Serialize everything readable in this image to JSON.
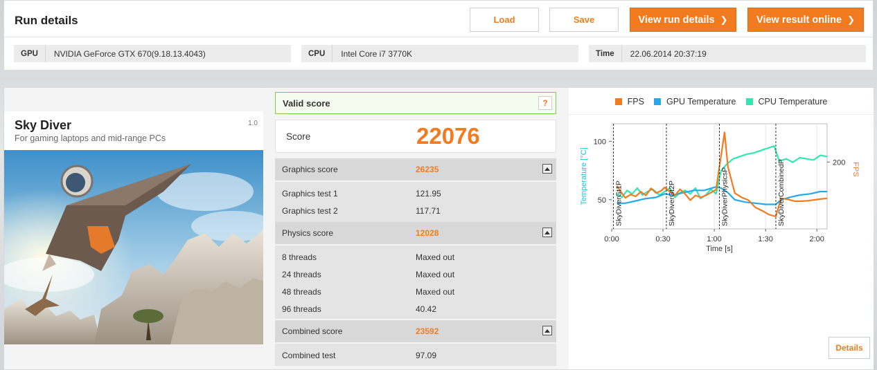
{
  "header": {
    "title": "Run details",
    "load_label": "Load",
    "save_label": "Save",
    "view_run_details_label": "View run details",
    "view_result_online_label": "View result online",
    "chevron": "❯"
  },
  "system": {
    "gpu_label": "GPU",
    "gpu_value": "NVIDIA GeForce GTX 670(9.18.13.4043)",
    "cpu_label": "CPU",
    "cpu_value": "Intel Core i7 3770K",
    "time_label": "Time",
    "time_value": "22.06.2014 20:37:19"
  },
  "test": {
    "name": "Sky Diver",
    "description": "For gaming laptops and mid-range PCs",
    "version": "1.0"
  },
  "results": {
    "valid_label": "Valid score",
    "help_label": "?",
    "score_label": "Score",
    "score_value": "22076",
    "graphics": {
      "label": "Graphics score",
      "value": "26235",
      "rows": [
        {
          "label": "Graphics test 1",
          "value": "121.95"
        },
        {
          "label": "Graphics test 2",
          "value": "117.71"
        }
      ]
    },
    "physics": {
      "label": "Physics score",
      "value": "12028",
      "rows": [
        {
          "label": "8 threads",
          "value": "Maxed out"
        },
        {
          "label": "24 threads",
          "value": "Maxed out"
        },
        {
          "label": "48 threads",
          "value": "Maxed out"
        },
        {
          "label": "96 threads",
          "value": "40.42"
        }
      ]
    },
    "combined": {
      "label": "Combined score",
      "value": "23592",
      "rows": [
        {
          "label": "Combined test",
          "value": "97.09"
        }
      ]
    }
  },
  "chart_data": {
    "type": "line",
    "legend": [
      "FPS",
      "GPU Temperature",
      "CPU Temperature"
    ],
    "colors": {
      "fps": "#f27b20",
      "gpu": "#27a8e8",
      "cpu": "#2ee8b0",
      "axis_left": "#1ec2d8",
      "axis_right": "#f27b20"
    },
    "xlabel": "Time [s]",
    "ylabel_left": "Temperature [°C]",
    "ylabel_right": "FPS",
    "x_ticks": [
      "0:00",
      "0:30",
      "1:00",
      "1:30",
      "2:00"
    ],
    "x_tick_values": [
      0,
      30,
      60,
      90,
      120
    ],
    "xlim": [
      0,
      126
    ],
    "y_left_ticks": [
      "50",
      "100"
    ],
    "y_left_tick_values": [
      50,
      100
    ],
    "ylim_left": [
      25,
      115
    ],
    "y_right_ticks": [
      "200"
    ],
    "y_right_tick_values": [
      200
    ],
    "ylim_right": [
      60,
      280
    ],
    "phases": [
      {
        "name": "SkyDiverGt1P",
        "t": 1
      },
      {
        "name": "SkyDiverGt2P",
        "t": 32
      },
      {
        "name": "SkyDiverPhysicsP",
        "t": 63
      },
      {
        "name": "SkyDiverCombinedP",
        "t": 96
      }
    ],
    "series": [
      {
        "name": "FPS",
        "axis": "right",
        "points": [
          [
            3,
            150
          ],
          [
            5,
            140
          ],
          [
            8,
            125
          ],
          [
            11,
            132
          ],
          [
            14,
            128
          ],
          [
            17,
            138
          ],
          [
            20,
            130
          ],
          [
            23,
            145
          ],
          [
            26,
            135
          ],
          [
            29,
            140
          ],
          [
            31,
            147
          ],
          [
            34,
            138
          ],
          [
            37,
            130
          ],
          [
            40,
            143
          ],
          [
            43,
            133
          ],
          [
            46,
            120
          ],
          [
            49,
            130
          ],
          [
            52,
            126
          ],
          [
            55,
            130
          ],
          [
            58,
            136
          ],
          [
            61,
            142
          ],
          [
            66,
            262
          ],
          [
            68,
            190
          ],
          [
            72,
            135
          ],
          [
            76,
            126
          ],
          [
            80,
            120
          ],
          [
            84,
            105
          ],
          [
            88,
            98
          ],
          [
            92,
            90
          ],
          [
            96,
            86
          ],
          [
            99,
            124
          ],
          [
            103,
            122
          ],
          [
            107,
            118
          ],
          [
            111,
            118
          ],
          [
            115,
            119
          ],
          [
            119,
            121
          ],
          [
            123,
            123
          ],
          [
            126,
            124
          ]
        ]
      },
      {
        "name": "GPU Temperature",
        "axis": "left",
        "points": [
          [
            3,
            47
          ],
          [
            8,
            47
          ],
          [
            14,
            49
          ],
          [
            20,
            51
          ],
          [
            26,
            52
          ],
          [
            31,
            55
          ],
          [
            36,
            54
          ],
          [
            42,
            56
          ],
          [
            48,
            58
          ],
          [
            54,
            58
          ],
          [
            61,
            61
          ],
          [
            64,
            60
          ],
          [
            68,
            56
          ],
          [
            72,
            50
          ],
          [
            78,
            48
          ],
          [
            84,
            47
          ],
          [
            90,
            46
          ],
          [
            96,
            46
          ],
          [
            99,
            50
          ],
          [
            104,
            52
          ],
          [
            110,
            54
          ],
          [
            116,
            55
          ],
          [
            122,
            57
          ],
          [
            126,
            57
          ]
        ]
      },
      {
        "name": "CPU Temperature",
        "axis": "left",
        "points": [
          [
            3,
            55
          ],
          [
            6,
            52
          ],
          [
            9,
            58
          ],
          [
            12,
            55
          ],
          [
            15,
            60
          ],
          [
            18,
            54
          ],
          [
            21,
            57
          ],
          [
            24,
            59
          ],
          [
            28,
            54
          ],
          [
            31,
            57
          ],
          [
            34,
            60
          ],
          [
            37,
            52
          ],
          [
            40,
            56
          ],
          [
            43,
            58
          ],
          [
            46,
            55
          ],
          [
            49,
            60
          ],
          [
            52,
            51
          ],
          [
            55,
            54
          ],
          [
            58,
            59
          ],
          [
            61,
            55
          ],
          [
            64,
            75
          ],
          [
            67,
            80
          ],
          [
            71,
            85
          ],
          [
            75,
            87
          ],
          [
            79,
            89
          ],
          [
            83,
            90
          ],
          [
            87,
            92
          ],
          [
            91,
            94
          ],
          [
            95,
            96
          ],
          [
            98,
            83
          ],
          [
            102,
            85
          ],
          [
            106,
            82
          ],
          [
            110,
            86
          ],
          [
            114,
            85
          ],
          [
            118,
            84
          ],
          [
            122,
            88
          ],
          [
            126,
            87
          ]
        ]
      }
    ]
  },
  "chart_panel": {
    "details_label": "Details"
  }
}
